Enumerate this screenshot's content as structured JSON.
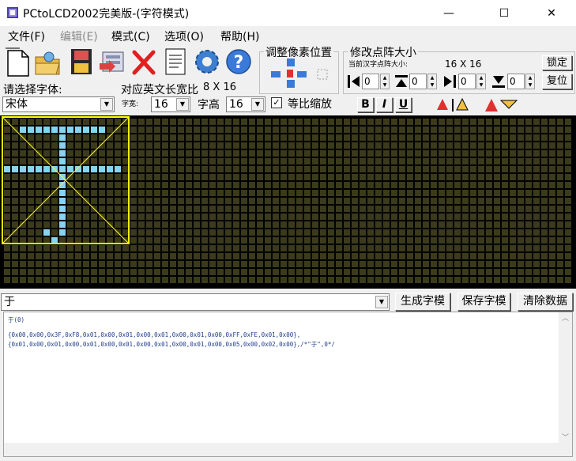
{
  "window": {
    "title": "PCtoLCD2002完美版-(字符模式)",
    "minimize_glyph": "—",
    "maximize_glyph": "☐",
    "close_glyph": "✕"
  },
  "menu": [
    {
      "label": "文件(F)",
      "enabled": true
    },
    {
      "label": "编辑(E)",
      "enabled": false
    },
    {
      "label": "模式(C)",
      "enabled": true
    },
    {
      "label": "选项(O)",
      "enabled": true
    },
    {
      "label": "帮助(H)",
      "enabled": true
    }
  ],
  "toolbar": {
    "icons": [
      "new-file-icon",
      "open-folder-icon",
      "save-disk-icon",
      "export-icon",
      "delete-x-icon",
      "notepad-icon",
      "settings-gear-icon",
      "help-icon"
    ]
  },
  "adjust": {
    "title": "调整像素位置"
  },
  "resize": {
    "title": "修改点阵大小",
    "current_label": "当前汉字点阵大小:",
    "current_value": "16 X 16",
    "lock_label": "锁定",
    "restore_label": "复位",
    "spinners": [
      "0",
      "0",
      "0",
      "0"
    ]
  },
  "font": {
    "select_label": "请选择字体:",
    "ratio_label": "对应英文长宽比",
    "ratio_value": "8 X 16",
    "font_name": "宋体",
    "width_label": "字宽:",
    "width_value": "16",
    "height_label": "字高",
    "height_value": "16",
    "proportional_label": "等比缩放",
    "proportional_checked": true,
    "bold_label": "B",
    "italic_label": "I",
    "underline_label": "U"
  },
  "input": {
    "text": "于",
    "generate_label": "生成字模",
    "save_label": "保存字模",
    "clear_label": "清除数据"
  },
  "output": {
    "lines": [
      "于(0)",
      "",
      "{0x00,0x00,0x3F,0xF8,0x01,0x00,0x01,0x00,0x01,0x00,0x01,0x00,0xFF,0xFE,0x01,0x00},",
      "{0x01,0x00,0x01,0x00,0x01,0x00,0x01,0x00,0x01,0x00,0x01,0x00,0x05,0x00,0x02,0x00},/*\"于\",0*/"
    ]
  },
  "glyph_bitmap": [
    "0000000000000000",
    "0011111111111000",
    "0000000100000000",
    "0000000100000000",
    "0000000100000000",
    "0000000100000000",
    "1111111111111110",
    "0000000100000000",
    "0000000100000000",
    "0000000100000000",
    "0000000100000000",
    "0000000100000000",
    "0000000100000000",
    "0000000100000000",
    "0000010100000000",
    "0000001000000000"
  ],
  "colors": {
    "grid_bg": "#000000",
    "cell_off": "#3b3b1c",
    "cell_on": "#87d3f0",
    "frame": "#ffff00"
  }
}
